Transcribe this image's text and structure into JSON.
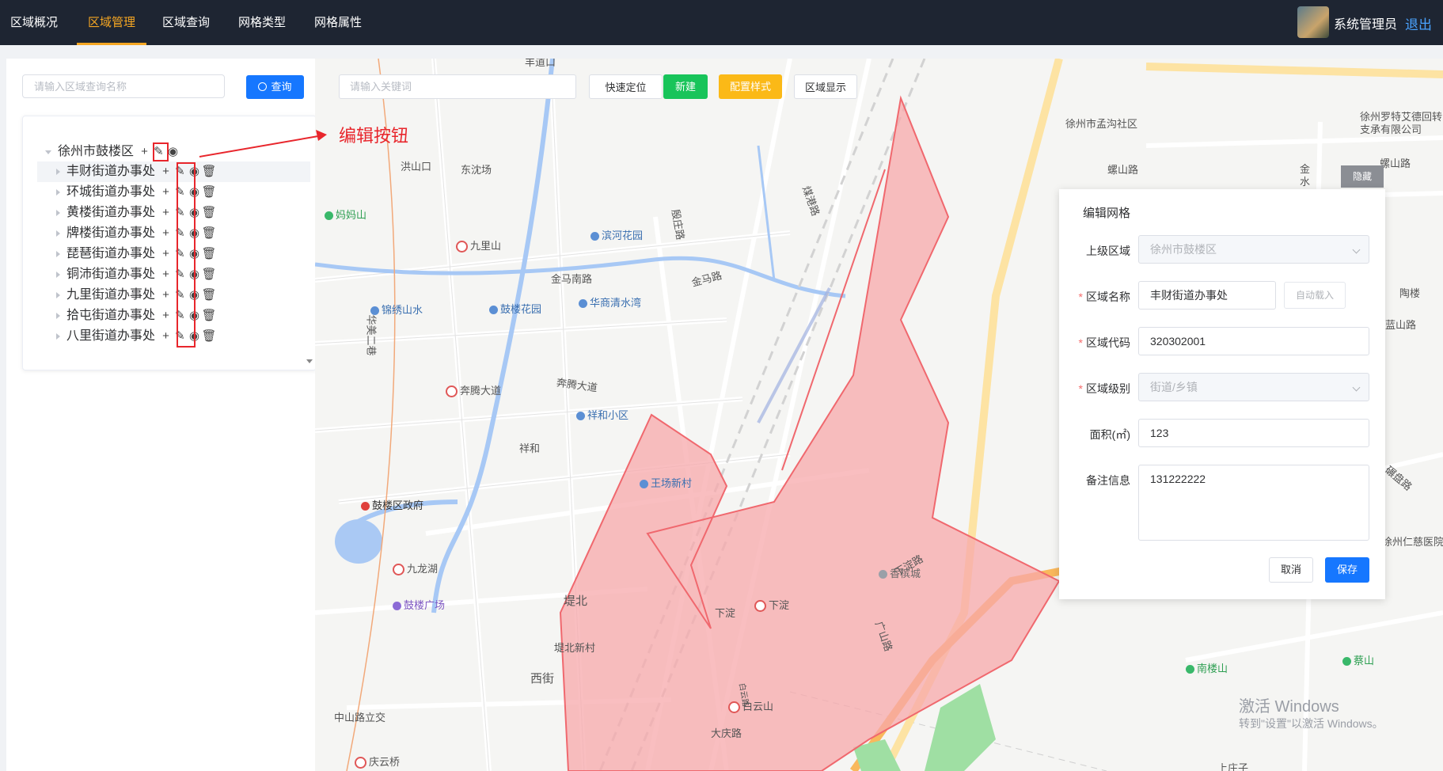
{
  "nav": {
    "items": [
      "区域概况",
      "区域管理",
      "区域查询",
      "网格类型",
      "网格属性"
    ],
    "active_index": 1,
    "username": "系统管理员",
    "logout": "退出"
  },
  "left": {
    "search_placeholder": "请输入区域查询名称",
    "query_button": "查询",
    "tree": {
      "root": "徐州市鼓楼区",
      "children": [
        "丰财街道办事处",
        "环城街道办事处",
        "黄楼街道办事处",
        "牌楼街道办事处",
        "琵琶街道办事处",
        "铜沛街道办事处",
        "九里街道办事处",
        "拾屯街道办事处",
        "八里街道办事处"
      ]
    }
  },
  "map_toolbar": {
    "search_placeholder": "请输入关键词",
    "quick_locate": "快速定位",
    "new": "新建",
    "config_style": "配置样式",
    "region_display": "区域显示",
    "hide": "隐藏"
  },
  "annotation": "编辑按钮",
  "colors": {
    "nav_bg": "#1e2532",
    "accent": "#f5a623",
    "primary": "#1677ff",
    "new_green": "#18c45a",
    "config_yellow": "#fbb917",
    "region_fill": "#f7a8ab",
    "region_stroke": "#f0686e"
  },
  "map_labels": {
    "hongshankou": "洪山口",
    "dongshenchang": "东沈场",
    "mamashan": "妈妈山",
    "jiulishan": "九里山",
    "binhehuayuan": "滨河花园",
    "jinmananlu": "金马南路",
    "jinmalu": "金马路",
    "hua_mei_er_xiang": "华美二巷",
    "jinxiushanshui": "锦绣山水",
    "gulouhuayuan": "鼓楼花园",
    "huashangqingshuiwan": "华商清水湾",
    "benteng_dadao": "奔腾大道",
    "benteng_dadao2": "奔腾大道",
    "xianghexiaoqu": "祥和小区",
    "xianghe": "祥和",
    "wangchangxincun": "王场新村",
    "guloquzhengfu": "鼓楼区政府",
    "jiulonghu": "九龙湖",
    "gulouguangchang": "鼓楼广场",
    "dibei": "堤北",
    "dibeixincun": "堤北新村",
    "xijie": "西街",
    "zhongshanluli": "中山路立交",
    "qingyunqiao": "庆云桥",
    "baiyunshan": "白云山",
    "daqinglu": "大庆路",
    "xiadian": "下淀",
    "xiadian2": "下淀",
    "xiadianlu": "下淀路",
    "xiangbincheng": "香槟城",
    "guangshanlu": "广山路",
    "meigangliu": "煤港路",
    "yinzhuanglu": "殷庄路",
    "mengguoshequ": "徐州市孟沟社区",
    "luoteaide": "徐州罗特艾德回转支承有限公司",
    "shanlu1": "螺山路",
    "shanlu2": "螺山路",
    "jinshui": "金水",
    "taolou": "陶楼",
    "lanshanlu": "蓝山路",
    "nanloushan": "南楼山",
    "caishan": "蔡山",
    "renci": "徐州仁慈医院",
    "shangzhuang": "上庄子",
    "baiyunlu_vert": "白云路",
    "zaishan_lu": "碾盘路",
    "fengdaokou": "丰道口"
  },
  "dialog": {
    "title": "编辑网格",
    "parent_label": "上级区域",
    "parent_value": "徐州市鼓楼区",
    "name_label": "区域名称",
    "name_value": "丰财街道办事处",
    "auto_load": "自动载入",
    "code_label": "区域代码",
    "code_value": "320302001",
    "level_label": "区域级别",
    "level_value": "街道/乡镇",
    "area_label": "面积(㎡)",
    "area_value": "123",
    "remark_label": "备注信息",
    "remark_value": "131222222",
    "cancel": "取消",
    "save": "保存"
  },
  "watermark": {
    "line1": "激活 Windows",
    "line2": "转到\"设置\"以激活 Windows。"
  }
}
